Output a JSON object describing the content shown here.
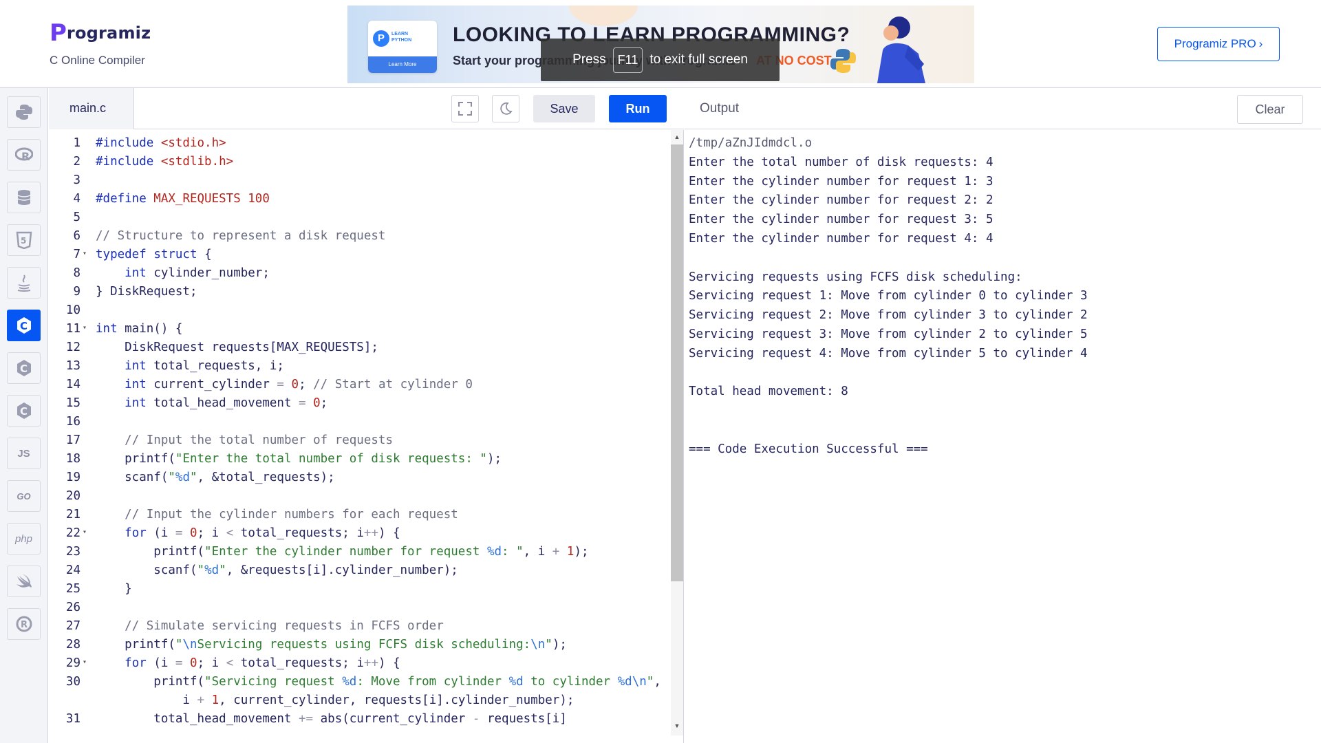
{
  "header": {
    "logo_mark": "P",
    "logo_text": "rogramiz",
    "subtitle": "C Online Compiler",
    "pro_button": "Programiz PRO",
    "pro_chevron": "›"
  },
  "banner": {
    "card_label_1": "LEARN",
    "card_label_2": "PYTHON",
    "card_p": "P",
    "learn_more": "Learn More",
    "title": "LOOKING TO LEARN PROGRAMMING?",
    "subtitle": "Start your programming journey with Programiz",
    "cost": "AT NO COST."
  },
  "fullscreen_toast": {
    "press": "Press",
    "key": "F11",
    "message": "to exit full screen"
  },
  "sidebar": {
    "items": [
      {
        "name": "python",
        "icon": "python-icon",
        "active": false
      },
      {
        "name": "r",
        "icon": "r-icon",
        "active": false
      },
      {
        "name": "sql",
        "icon": "database-icon",
        "active": false
      },
      {
        "name": "html",
        "icon": "html5-icon",
        "active": false
      },
      {
        "name": "java",
        "icon": "java-icon",
        "active": false
      },
      {
        "name": "c",
        "icon": "c-icon",
        "active": true
      },
      {
        "name": "cpp",
        "icon": "cpp-icon",
        "active": false
      },
      {
        "name": "csharp",
        "icon": "csharp-icon",
        "active": false
      },
      {
        "name": "javascript",
        "icon": "js-icon",
        "label": "JS",
        "active": false
      },
      {
        "name": "go",
        "icon": "go-icon",
        "label": "GO",
        "active": false
      },
      {
        "name": "php",
        "icon": "php-icon",
        "label": "php",
        "active": false
      },
      {
        "name": "swift",
        "icon": "swift-icon",
        "active": false
      },
      {
        "name": "rust",
        "icon": "rust-icon",
        "active": false
      }
    ],
    "active_color": "#0556f3"
  },
  "editor": {
    "file_tab": "main.c",
    "save_label": "Save",
    "run_label": "Run",
    "lines": [
      {
        "n": "1",
        "code": "#include <stdio.h>"
      },
      {
        "n": "2",
        "code": "#include <stdlib.h>"
      },
      {
        "n": "3",
        "code": ""
      },
      {
        "n": "4",
        "code": "#define MAX_REQUESTS 100"
      },
      {
        "n": "5",
        "code": ""
      },
      {
        "n": "6",
        "code": "// Structure to represent a disk request"
      },
      {
        "n": "7",
        "code": "typedef struct {",
        "fold": true
      },
      {
        "n": "8",
        "code": "    int cylinder_number;"
      },
      {
        "n": "9",
        "code": "} DiskRequest;"
      },
      {
        "n": "10",
        "code": ""
      },
      {
        "n": "11",
        "code": "int main() {",
        "fold": true
      },
      {
        "n": "12",
        "code": "    DiskRequest requests[MAX_REQUESTS];"
      },
      {
        "n": "13",
        "code": "    int total_requests, i;"
      },
      {
        "n": "14",
        "code": "    int current_cylinder = 0; // Start at cylinder 0"
      },
      {
        "n": "15",
        "code": "    int total_head_movement = 0;"
      },
      {
        "n": "16",
        "code": ""
      },
      {
        "n": "17",
        "code": "    // Input the total number of requests"
      },
      {
        "n": "18",
        "code": "    printf(\"Enter the total number of disk requests: \");"
      },
      {
        "n": "19",
        "code": "    scanf(\"%d\", &total_requests);"
      },
      {
        "n": "20",
        "code": ""
      },
      {
        "n": "21",
        "code": "    // Input the cylinder numbers for each request"
      },
      {
        "n": "22",
        "code": "    for (i = 0; i < total_requests; i++) {",
        "fold": true
      },
      {
        "n": "23",
        "code": "        printf(\"Enter the cylinder number for request %d: \", i + 1);"
      },
      {
        "n": "24",
        "code": "        scanf(\"%d\", &requests[i].cylinder_number);"
      },
      {
        "n": "25",
        "code": "    }"
      },
      {
        "n": "26",
        "code": ""
      },
      {
        "n": "27",
        "code": "    // Simulate servicing requests in FCFS order"
      },
      {
        "n": "28",
        "code": "    printf(\"\\nServicing requests using FCFS disk scheduling:\\n\");"
      },
      {
        "n": "29",
        "code": "    for (i = 0; i < total_requests; i++) {",
        "fold": true
      },
      {
        "n": "30",
        "code": "        printf(\"Servicing request %d: Move from cylinder %d to cylinder %d\\n\","
      },
      {
        "n": "",
        "code": "            i + 1, current_cylinder, requests[i].cylinder_number);"
      },
      {
        "n": "31",
        "code": "        total_head_movement += abs(current_cylinder - requests[i]"
      }
    ]
  },
  "output": {
    "title": "Output",
    "clear_label": "Clear",
    "lines": [
      "/tmp/aZnJIdmdcl.o",
      "Enter the total number of disk requests: 4",
      "Enter the cylinder number for request 1: 3",
      "Enter the cylinder number for request 2: 2",
      "Enter the cylinder number for request 3: 5",
      "Enter the cylinder number for request 4: 4",
      "",
      "Servicing requests using FCFS disk scheduling:",
      "Servicing request 1: Move from cylinder 0 to cylinder 3",
      "Servicing request 2: Move from cylinder 3 to cylinder 2",
      "Servicing request 3: Move from cylinder 2 to cylinder 5",
      "Servicing request 4: Move from cylinder 5 to cylinder 4",
      "",
      "Total head movement: 8",
      "",
      "",
      "=== Code Execution Successful ==="
    ]
  }
}
